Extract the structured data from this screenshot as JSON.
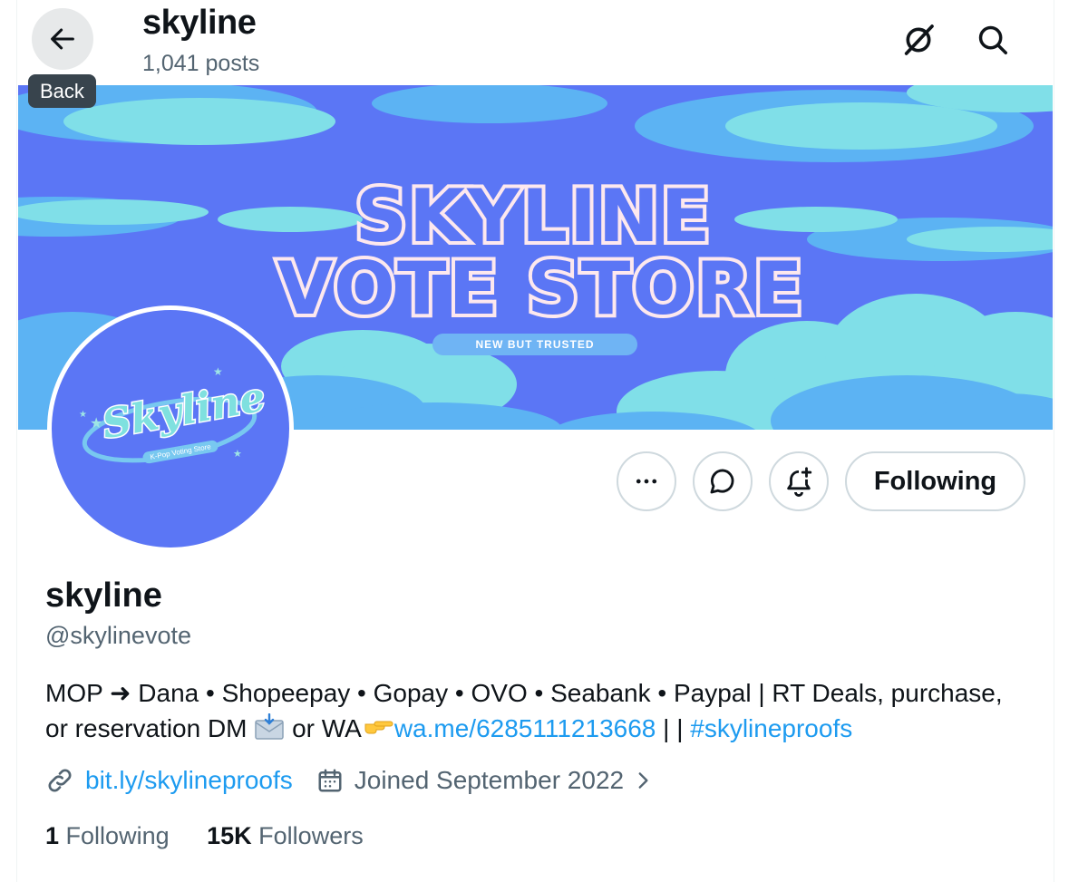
{
  "header": {
    "back_tooltip": "Back",
    "title": "skyline",
    "posts": "1,041 posts"
  },
  "banner": {
    "line1": "SKYLINE",
    "line2": "VOTE STORE",
    "tagline": "NEW BUT TRUSTED"
  },
  "avatar": {
    "logo_text": "Skyline",
    "logo_sub": "K-Pop Voting Store"
  },
  "actions": {
    "follow_label": "Following"
  },
  "profile": {
    "name": "skyline",
    "handle": "@skylinevote",
    "bio_line1": "MOP ➜ Dana • Shopeepay • Gopay • OVO • Seabank • Paypal | RT Deals, purchase,",
    "bio_line2_a": "or reservation DM ",
    "bio_line2_b": " or WA",
    "bio_wa_link": "wa.me/6285111213668",
    "bio_sep": " | | ",
    "bio_hashtag": "#skylineproofs",
    "website": "bit.ly/skylineproofs",
    "joined": "Joined September 2022"
  },
  "stats": {
    "following_count": "1",
    "following_label": "Following",
    "followers_count": "15K",
    "followers_label": "Followers"
  },
  "colors": {
    "link": "#1d9bf0",
    "secondary_text": "#536471",
    "banner_bg": "#5b76f5",
    "cloud_light": "#80dfe8",
    "cloud_mid": "#5cb3f3"
  }
}
